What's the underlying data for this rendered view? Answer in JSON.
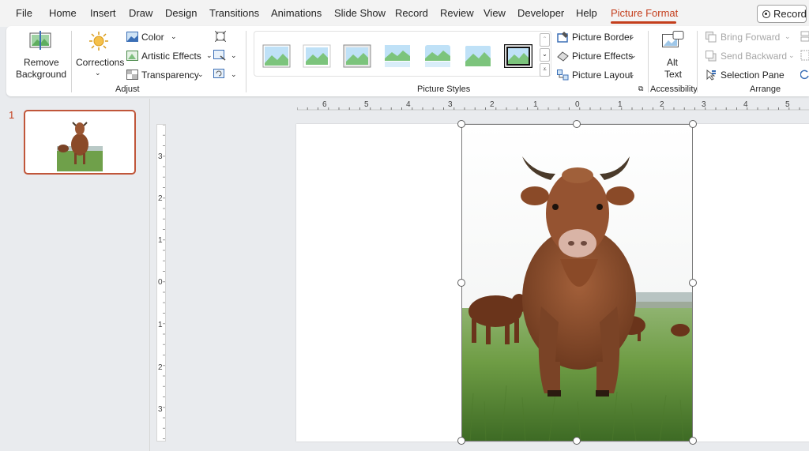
{
  "menu": {
    "items": [
      "File",
      "Home",
      "Insert",
      "Draw",
      "Design",
      "Transitions",
      "Animations",
      "Slide Show",
      "Record",
      "Review",
      "View",
      "Developer",
      "Help",
      "Picture Format"
    ],
    "active": "Picture Format",
    "record_button": "Record"
  },
  "ribbon": {
    "adjust": {
      "remove_background": [
        "Remove",
        "Background"
      ],
      "corrections": "Corrections",
      "color": "Color",
      "artistic_effects": "Artistic Effects",
      "transparency": "Transparency",
      "label": "Adjust"
    },
    "picture_styles": {
      "label": "Picture Styles",
      "picture_border": "Picture Border",
      "picture_effects": "Picture Effects",
      "picture_layout": "Picture Layout"
    },
    "accessibility": {
      "alt_text": [
        "Alt",
        "Text"
      ],
      "label": "Accessibility"
    },
    "arrange": {
      "bring_forward": "Bring Forward",
      "send_backward": "Send Backward",
      "selection_pane": "Selection Pane",
      "label": "Arrange"
    }
  },
  "slides": {
    "current_number": "1"
  },
  "rulers": {
    "horizontal": [
      "6",
      "5",
      "4",
      "3",
      "2",
      "1",
      "0",
      "1",
      "2",
      "3",
      "4",
      "5"
    ],
    "vertical": [
      "3",
      "2",
      "1",
      "0",
      "1",
      "2",
      "3"
    ]
  },
  "colors": {
    "accent": "#c43e1c",
    "ribbon_bg": "#ffffff",
    "app_bg": "#e9ebee"
  }
}
